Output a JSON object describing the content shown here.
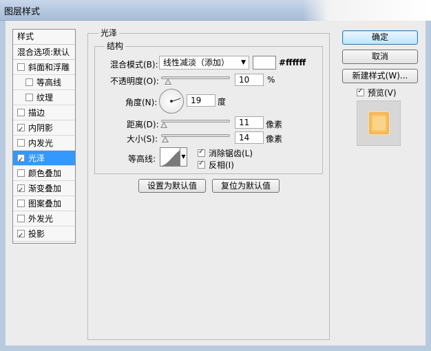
{
  "window": {
    "title": "图层样式"
  },
  "style_list": {
    "header": "样式",
    "blend_options": "混合选项:默认",
    "items": [
      {
        "label": "斜面和浮雕",
        "checked": false,
        "sub": false
      },
      {
        "label": "等高线",
        "checked": false,
        "sub": true
      },
      {
        "label": "纹理",
        "checked": false,
        "sub": true
      },
      {
        "label": "描边",
        "checked": false,
        "sub": false
      },
      {
        "label": "内阴影",
        "checked": true,
        "sub": false
      },
      {
        "label": "内发光",
        "checked": false,
        "sub": false
      },
      {
        "label": "光泽",
        "checked": true,
        "sub": false,
        "selected": true
      },
      {
        "label": "颜色叠加",
        "checked": false,
        "sub": false
      },
      {
        "label": "渐变叠加",
        "checked": true,
        "sub": false
      },
      {
        "label": "图案叠加",
        "checked": false,
        "sub": false
      },
      {
        "label": "外发光",
        "checked": false,
        "sub": false
      },
      {
        "label": "投影",
        "checked": true,
        "sub": false
      }
    ]
  },
  "satin": {
    "group_title": "光泽",
    "structure_title": "结构",
    "blend_mode_label": "混合模式(B):",
    "blend_mode_value": "线性减淡（添加）",
    "color_hex": "#ffffff",
    "opacity_label": "不透明度(O):",
    "opacity_value": "10",
    "opacity_unit": "%",
    "angle_label": "角度(N):",
    "angle_value": "19",
    "angle_unit": "度",
    "distance_label": "距离(D):",
    "distance_value": "11",
    "distance_unit": "像素",
    "size_label": "大小(S):",
    "size_value": "14",
    "size_unit": "像素",
    "contour_label": "等高线:",
    "anti_alias_label": "消除锯齿(L)",
    "anti_alias_checked": true,
    "invert_label": "反相(I)",
    "invert_checked": true,
    "opacity_fraction": 0.1,
    "distance_fraction": 0.044,
    "size_fraction": 0.056,
    "set_default_label": "设置为默认值",
    "reset_default_label": "复位为默认值"
  },
  "buttons": {
    "ok": "确定",
    "cancel": "取消",
    "new_style": "新建样式(W)...",
    "preview_label": "预览(V)",
    "preview_checked": true
  }
}
